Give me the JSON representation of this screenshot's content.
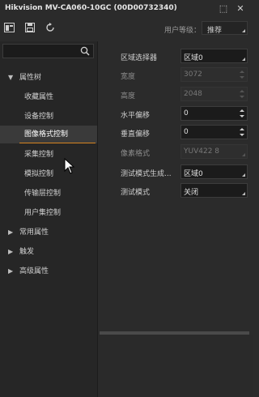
{
  "window": {
    "title": "Hikvision MV-CA060-10GC (00D00732340)",
    "float_glyph": "⬚",
    "close_glyph": "✕"
  },
  "toolbar": {
    "level_label": "用户等级：",
    "level_value": "推荐"
  },
  "tree": {
    "root_label": "属性树",
    "children": [
      "收藏属性",
      "设备控制",
      "图像格式控制",
      "采集控制",
      "模拟控制",
      "传输层控制",
      "用户集控制"
    ],
    "selected_index": 2,
    "groups": [
      "常用属性",
      "触发",
      "高级属性"
    ]
  },
  "properties": [
    {
      "label": "区域选择器",
      "value": "区域0",
      "control": "combo",
      "enabled": true
    },
    {
      "label": "宽度",
      "value": "3072",
      "control": "spin",
      "enabled": false
    },
    {
      "label": "高度",
      "value": "2048",
      "control": "spin",
      "enabled": false
    },
    {
      "label": "水平偏移",
      "value": "0",
      "control": "spin",
      "enabled": true
    },
    {
      "label": "垂直偏移",
      "value": "0",
      "control": "spin",
      "enabled": true
    },
    {
      "label": "像素格式",
      "value": "YUV422 8",
      "control": "combo",
      "enabled": false
    },
    {
      "label": "测试模式生成...",
      "value": "区域0",
      "control": "combo",
      "enabled": true
    },
    {
      "label": "测试模式",
      "value": "关闭",
      "control": "combo",
      "enabled": true
    }
  ],
  "colors": {
    "accent": "#d88420",
    "background": "#2b2b2b",
    "sidebar": "#262626",
    "field": "#1b1b1b"
  },
  "icons": [
    "dock-icon",
    "save-icon",
    "refresh-icon",
    "search-icon",
    "expand-chevron-icon",
    "collapse-chevron-icon",
    "mouse-pointer-icon"
  ]
}
